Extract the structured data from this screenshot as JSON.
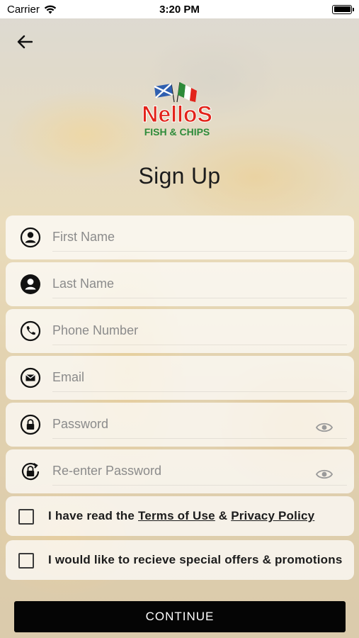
{
  "status_bar": {
    "carrier": "Carrier",
    "time": "3:20 PM"
  },
  "header": {
    "title": "Sign Up",
    "logo_text": "NelloS",
    "logo_subtext": "FISH & CHIPS"
  },
  "fields": [
    {
      "placeholder": "First Name",
      "value": "",
      "icon": "user-circle-outline-icon"
    },
    {
      "placeholder": "Last Name",
      "value": "",
      "icon": "user-circle-filled-icon"
    },
    {
      "placeholder": "Phone Number",
      "value": "",
      "icon": "phone-icon"
    },
    {
      "placeholder": "Email",
      "value": "",
      "icon": "mail-icon"
    },
    {
      "placeholder": "Password",
      "value": "",
      "icon": "lock-icon"
    },
    {
      "placeholder": "Re-enter Password",
      "value": "",
      "icon": "lock-refresh-icon"
    }
  ],
  "terms": {
    "prefix": "I have read the",
    "terms_link": "Terms of Use",
    "amp": "&",
    "privacy_link": "Privacy Policy",
    "checked": false
  },
  "offers": {
    "label": "I would like to recieve special offers & promotions",
    "checked": false
  },
  "continue_label": "CONTINUE",
  "colors": {
    "logo_red": "#e2231a",
    "logo_green": "#2e8b3a",
    "button": "#050505"
  }
}
